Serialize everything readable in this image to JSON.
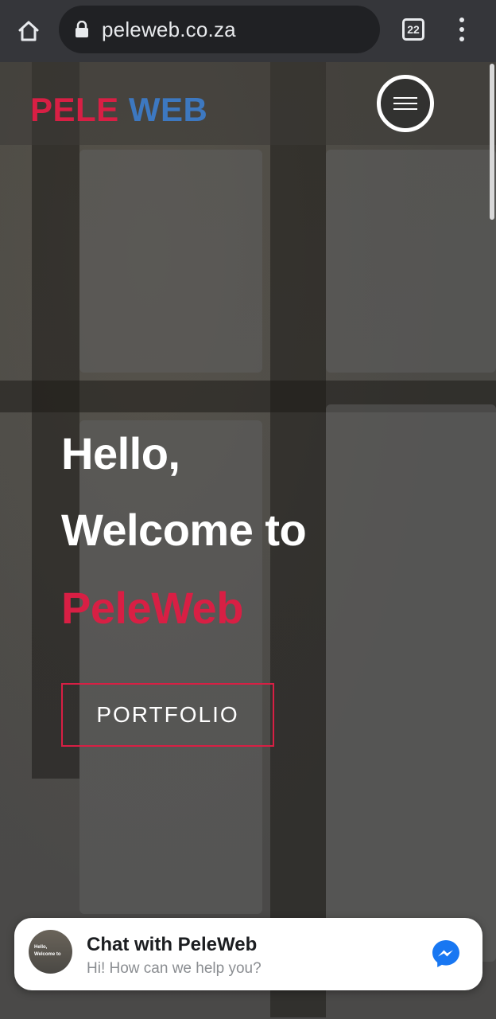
{
  "browser": {
    "url": "peleweb.co.za",
    "tab_count": "22"
  },
  "site": {
    "brand_part1": "PELE ",
    "brand_part2": "WEB",
    "colors": {
      "accent_red": "#d81f44",
      "accent_blue": "#3d78c0"
    }
  },
  "hero": {
    "line1": "Hello,",
    "line2": "Welcome to",
    "line3": "PeleWeb",
    "button_label": "PORTFOLIO"
  },
  "chat": {
    "title": "Chat with PeleWeb",
    "subtitle": "Hi! How can we help you?",
    "avatar_text_1": "Hello,",
    "avatar_text_2": "Welcome to"
  }
}
